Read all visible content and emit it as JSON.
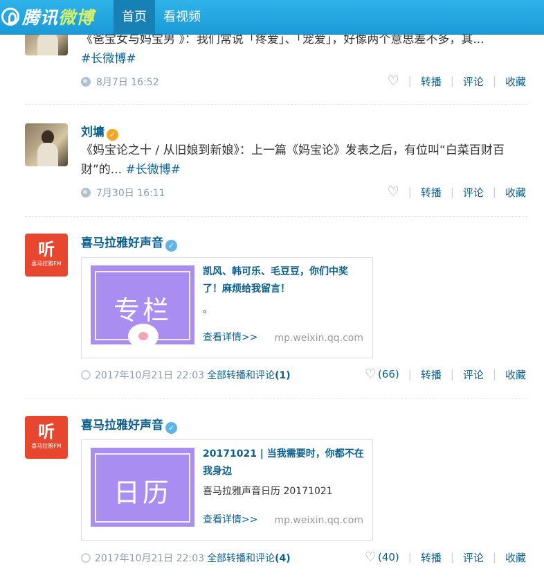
{
  "header": {
    "logo_text_a": "腾讯",
    "logo_text_b": "微博",
    "tabs": [
      {
        "label": "首页",
        "active": true
      },
      {
        "label": "看视频",
        "active": false
      }
    ]
  },
  "posts": [
    {
      "name": "",
      "text": "《爸宝女与妈宝男 》：我们常说「疼爱」、「宠爱」，好像两个意思差不多，其...",
      "tag": "#长微博#",
      "time": "8月7日 16:52",
      "actions": {
        "repost": "转播",
        "comment": "评论",
        "fav": "收藏"
      }
    },
    {
      "name": "刘墉",
      "text": "《妈宝论之十 / 从旧娘到新娘》：上一篇《妈宝论》发表之后，有位叫“白菜百财百财”的...",
      "tag": "#长微博#",
      "time": "7月30日 16:11",
      "actions": {
        "repost": "转播",
        "comment": "评论",
        "fav": "收藏"
      }
    },
    {
      "name": "喜马拉雅好声音",
      "avatar_text": "听",
      "avatar_sub": "喜马拉雅FM",
      "card": {
        "thumb_text": "专栏",
        "title": "凯风、韩可乐、毛豆豆，你们中奖了！麻烦给我留言！",
        "desc": "。",
        "more": "查看详情>>",
        "domain": "mp.weixin.qq.com"
      },
      "time": "2017年10月21日 22:03",
      "all_label": "全部转播和评论",
      "all_count": "(1)",
      "likes": "(66)",
      "actions": {
        "repost": "转播",
        "comment": "评论",
        "fav": "收藏"
      }
    },
    {
      "name": "喜马拉雅好声音",
      "avatar_text": "听",
      "avatar_sub": "喜马拉雅FM",
      "card": {
        "thumb_text": "日历",
        "title": "20171021 | 当我需要时，你都不在我身边",
        "desc": "喜马拉雅声音日历 20171021",
        "more": "查看详情>>",
        "domain": "mp.weixin.qq.com"
      },
      "time": "2017年10月21日 22:03",
      "all_label": "全部转播和评论",
      "all_count": "(4)",
      "likes": "(40)",
      "actions": {
        "repost": "转播",
        "comment": "评论",
        "fav": "收藏"
      }
    }
  ]
}
